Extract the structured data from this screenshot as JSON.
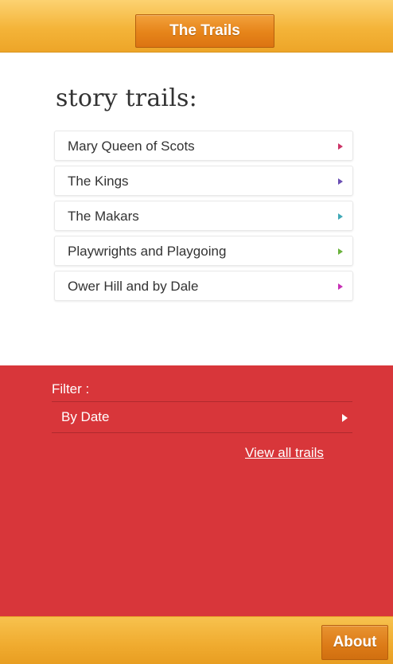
{
  "header": {
    "title_button": "The Trails"
  },
  "main": {
    "section_title": "story trails:",
    "trails": [
      {
        "label": "Mary Queen of Scots",
        "arrow_color": "#cc3366"
      },
      {
        "label": "The Kings",
        "arrow_color": "#6a4fb3"
      },
      {
        "label": "The Makars",
        "arrow_color": "#3fa8b6"
      },
      {
        "label": "Playwrights and Playgoing",
        "arrow_color": "#6ab23c"
      },
      {
        "label": "Ower Hill and by Dale",
        "arrow_color": "#c72fb5"
      }
    ]
  },
  "filter": {
    "title": "Filter :",
    "option_label": "By Date",
    "view_all_label": "View all trails",
    "background_color": "#d8363a"
  },
  "footer": {
    "about_label": "About"
  },
  "colors": {
    "header_accent": "#f4b439",
    "button_orange": "#e68419",
    "filter_red": "#d8363a"
  },
  "icons": {
    "trail_arrow": "triangle-right-icon",
    "filter_arrow": "triangle-right-icon"
  }
}
